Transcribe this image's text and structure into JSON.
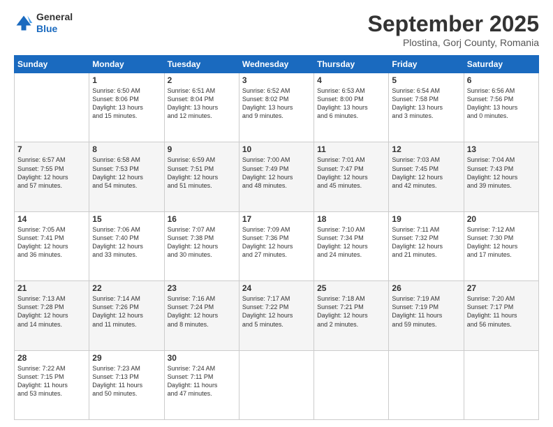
{
  "header": {
    "logo": {
      "general": "General",
      "blue": "Blue"
    },
    "title": "September 2025",
    "location": "Plostina, Gorj County, Romania"
  },
  "days_of_week": [
    "Sunday",
    "Monday",
    "Tuesday",
    "Wednesday",
    "Thursday",
    "Friday",
    "Saturday"
  ],
  "weeks": [
    [
      {
        "day": "",
        "content": ""
      },
      {
        "day": "1",
        "content": "Sunrise: 6:50 AM\nSunset: 8:06 PM\nDaylight: 13 hours\nand 15 minutes."
      },
      {
        "day": "2",
        "content": "Sunrise: 6:51 AM\nSunset: 8:04 PM\nDaylight: 13 hours\nand 12 minutes."
      },
      {
        "day": "3",
        "content": "Sunrise: 6:52 AM\nSunset: 8:02 PM\nDaylight: 13 hours\nand 9 minutes."
      },
      {
        "day": "4",
        "content": "Sunrise: 6:53 AM\nSunset: 8:00 PM\nDaylight: 13 hours\nand 6 minutes."
      },
      {
        "day": "5",
        "content": "Sunrise: 6:54 AM\nSunset: 7:58 PM\nDaylight: 13 hours\nand 3 minutes."
      },
      {
        "day": "6",
        "content": "Sunrise: 6:56 AM\nSunset: 7:56 PM\nDaylight: 13 hours\nand 0 minutes."
      }
    ],
    [
      {
        "day": "7",
        "content": "Sunrise: 6:57 AM\nSunset: 7:55 PM\nDaylight: 12 hours\nand 57 minutes."
      },
      {
        "day": "8",
        "content": "Sunrise: 6:58 AM\nSunset: 7:53 PM\nDaylight: 12 hours\nand 54 minutes."
      },
      {
        "day": "9",
        "content": "Sunrise: 6:59 AM\nSunset: 7:51 PM\nDaylight: 12 hours\nand 51 minutes."
      },
      {
        "day": "10",
        "content": "Sunrise: 7:00 AM\nSunset: 7:49 PM\nDaylight: 12 hours\nand 48 minutes."
      },
      {
        "day": "11",
        "content": "Sunrise: 7:01 AM\nSunset: 7:47 PM\nDaylight: 12 hours\nand 45 minutes."
      },
      {
        "day": "12",
        "content": "Sunrise: 7:03 AM\nSunset: 7:45 PM\nDaylight: 12 hours\nand 42 minutes."
      },
      {
        "day": "13",
        "content": "Sunrise: 7:04 AM\nSunset: 7:43 PM\nDaylight: 12 hours\nand 39 minutes."
      }
    ],
    [
      {
        "day": "14",
        "content": "Sunrise: 7:05 AM\nSunset: 7:41 PM\nDaylight: 12 hours\nand 36 minutes."
      },
      {
        "day": "15",
        "content": "Sunrise: 7:06 AM\nSunset: 7:40 PM\nDaylight: 12 hours\nand 33 minutes."
      },
      {
        "day": "16",
        "content": "Sunrise: 7:07 AM\nSunset: 7:38 PM\nDaylight: 12 hours\nand 30 minutes."
      },
      {
        "day": "17",
        "content": "Sunrise: 7:09 AM\nSunset: 7:36 PM\nDaylight: 12 hours\nand 27 minutes."
      },
      {
        "day": "18",
        "content": "Sunrise: 7:10 AM\nSunset: 7:34 PM\nDaylight: 12 hours\nand 24 minutes."
      },
      {
        "day": "19",
        "content": "Sunrise: 7:11 AM\nSunset: 7:32 PM\nDaylight: 12 hours\nand 21 minutes."
      },
      {
        "day": "20",
        "content": "Sunrise: 7:12 AM\nSunset: 7:30 PM\nDaylight: 12 hours\nand 17 minutes."
      }
    ],
    [
      {
        "day": "21",
        "content": "Sunrise: 7:13 AM\nSunset: 7:28 PM\nDaylight: 12 hours\nand 14 minutes."
      },
      {
        "day": "22",
        "content": "Sunrise: 7:14 AM\nSunset: 7:26 PM\nDaylight: 12 hours\nand 11 minutes."
      },
      {
        "day": "23",
        "content": "Sunrise: 7:16 AM\nSunset: 7:24 PM\nDaylight: 12 hours\nand 8 minutes."
      },
      {
        "day": "24",
        "content": "Sunrise: 7:17 AM\nSunset: 7:22 PM\nDaylight: 12 hours\nand 5 minutes."
      },
      {
        "day": "25",
        "content": "Sunrise: 7:18 AM\nSunset: 7:21 PM\nDaylight: 12 hours\nand 2 minutes."
      },
      {
        "day": "26",
        "content": "Sunrise: 7:19 AM\nSunset: 7:19 PM\nDaylight: 11 hours\nand 59 minutes."
      },
      {
        "day": "27",
        "content": "Sunrise: 7:20 AM\nSunset: 7:17 PM\nDaylight: 11 hours\nand 56 minutes."
      }
    ],
    [
      {
        "day": "28",
        "content": "Sunrise: 7:22 AM\nSunset: 7:15 PM\nDaylight: 11 hours\nand 53 minutes."
      },
      {
        "day": "29",
        "content": "Sunrise: 7:23 AM\nSunset: 7:13 PM\nDaylight: 11 hours\nand 50 minutes."
      },
      {
        "day": "30",
        "content": "Sunrise: 7:24 AM\nSunset: 7:11 PM\nDaylight: 11 hours\nand 47 minutes."
      },
      {
        "day": "",
        "content": ""
      },
      {
        "day": "",
        "content": ""
      },
      {
        "day": "",
        "content": ""
      },
      {
        "day": "",
        "content": ""
      }
    ]
  ]
}
